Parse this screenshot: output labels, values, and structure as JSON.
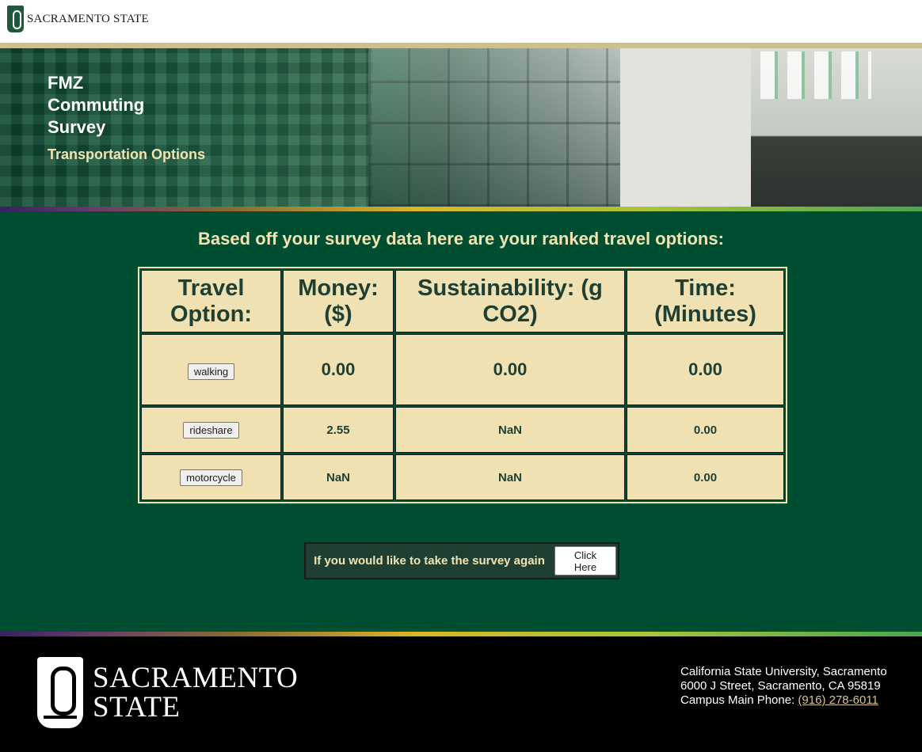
{
  "header": {
    "logo_text": "SACRAMENTO STATE"
  },
  "hero": {
    "title_lines": [
      "FMZ",
      "Commuting",
      "Survey"
    ],
    "subtitle": "Transportation Options"
  },
  "results": {
    "heading": "Based off your survey data here are your ranked travel options:",
    "columns": {
      "option_line1": "Travel",
      "option_line2": "Option:",
      "money_line1": "Money:",
      "money_line2": "($)",
      "sustain_line1": "Sustainability: (g",
      "sustain_line2": "CO2)",
      "time_line1": "Time:",
      "time_line2": "(Minutes)"
    },
    "rows": [
      {
        "option": "walking",
        "money": "0.00",
        "sustainability": "0.00",
        "time": "0.00"
      },
      {
        "option": "rideshare",
        "money": "2.55",
        "sustainability": "NaN",
        "time": "0.00"
      },
      {
        "option": "motorcycle",
        "money": "NaN",
        "sustainability": "NaN",
        "time": "0.00"
      }
    ]
  },
  "retake": {
    "label": "If you would like to take the survey again",
    "button_line1": "Click",
    "button_line2": "Here"
  },
  "footer": {
    "logo_line1": "SACRAMENTO",
    "logo_line2": "STATE",
    "address_line1": "California State University, Sacramento",
    "address_line2": "6000 J Street, Sacramento, CA 95819",
    "phone_label": "Campus Main Phone: ",
    "phone_number": "(916) 278-6011"
  },
  "colors": {
    "brand_green": "#004e32",
    "gold": "#f0e4b3",
    "table_cell": "#f0e1b3",
    "footer_bg": "#000000"
  }
}
